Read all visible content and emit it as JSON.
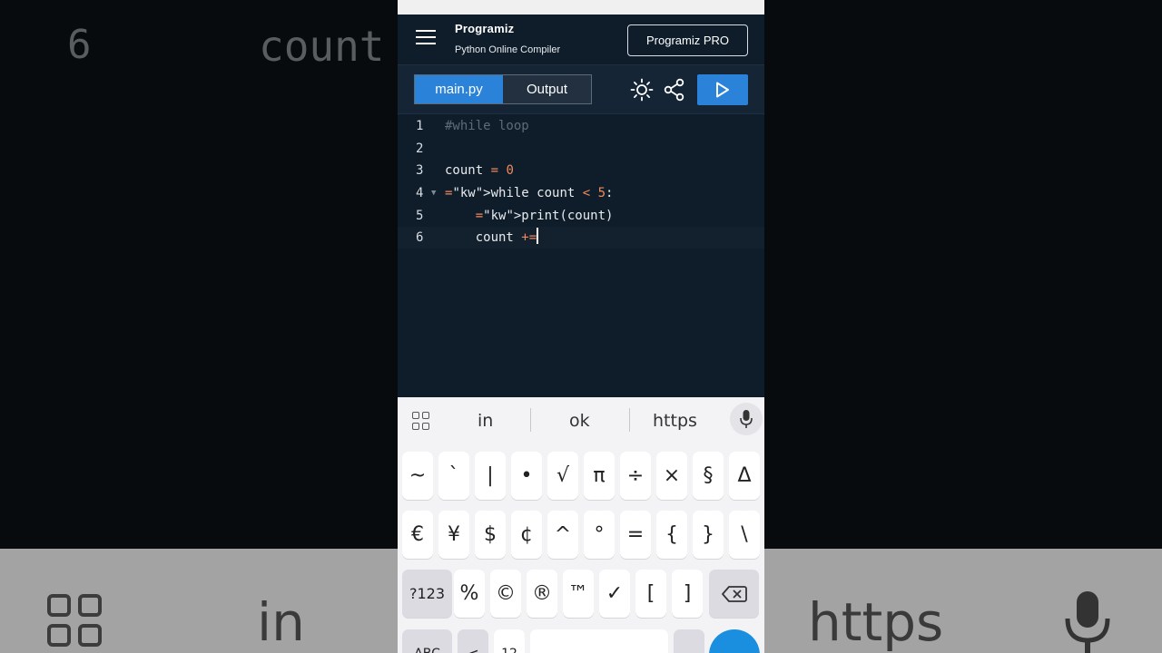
{
  "background": {
    "line_number": "6",
    "word": "count",
    "suggestion_left": "in",
    "suggestion_right": "https"
  },
  "header": {
    "brand": "Programiz",
    "subtitle": "Python Online Compiler",
    "pro_button": "Programiz PRO"
  },
  "tabs": [
    {
      "label": "main.py",
      "active": true
    },
    {
      "label": "Output",
      "active": false
    }
  ],
  "editor": {
    "lines": [
      {
        "number": "1",
        "code": "#while loop"
      },
      {
        "number": "2",
        "code": ""
      },
      {
        "number": "3",
        "code": "count = 0"
      },
      {
        "number": "4",
        "code": "while count < 5:"
      },
      {
        "number": "5",
        "code": "    print(count)"
      },
      {
        "number": "6",
        "code": "    count +="
      }
    ],
    "current_line": 6
  },
  "keyboard": {
    "suggestions": [
      "in",
      "ok",
      "https"
    ],
    "row1": [
      "~",
      "`",
      "|",
      "•",
      "√",
      "π",
      "÷",
      "×",
      "§",
      "Δ"
    ],
    "row2": [
      "€",
      "¥",
      "$",
      "¢",
      "^",
      "°",
      "=",
      "{",
      "}",
      "\\"
    ],
    "row3": [
      "?123",
      "%",
      "©",
      "®",
      "™",
      "✓",
      "[",
      "]"
    ],
    "row4": [
      "ABC",
      "<",
      "12",
      "",
      "",
      ""
    ]
  },
  "colors": {
    "accent": "#2b82d9",
    "editor_bg": "#0f1d2b",
    "keyword": "#f08a5d",
    "comment": "#5d6b77"
  }
}
